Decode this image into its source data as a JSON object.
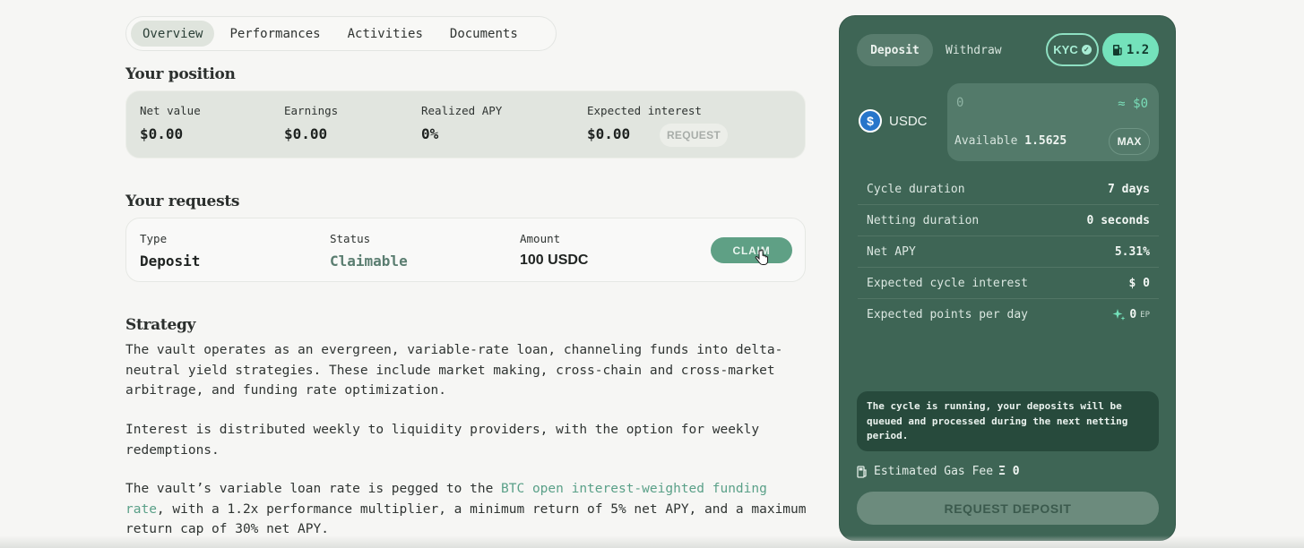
{
  "tabs": [
    {
      "label": "Overview",
      "active": true
    },
    {
      "label": "Performances",
      "active": false
    },
    {
      "label": "Activities",
      "active": false
    },
    {
      "label": "Documents",
      "active": false
    }
  ],
  "position": {
    "title": "Your position",
    "stats": [
      {
        "label": "Net value",
        "value": "$0.00"
      },
      {
        "label": "Earnings",
        "value": "$0.00"
      },
      {
        "label": "Realized APY",
        "value": "0%"
      },
      {
        "label": "Expected interest",
        "value": "$0.00"
      }
    ],
    "request_label": "REQUEST"
  },
  "requests": {
    "title": "Your requests",
    "columns": [
      {
        "label": "Type",
        "value": "Deposit"
      },
      {
        "label": "Status",
        "value": "Claimable"
      },
      {
        "label": "Amount",
        "value": "100 USDC"
      }
    ],
    "claim_label": "CLAIM"
  },
  "strategy": {
    "title": "Strategy",
    "p1": "The vault operates as an evergreen, variable-rate loan, channeling funds into delta-neutral yield strategies. These include market making, cross-chain and cross-market arbitrage, and funding rate optimization.",
    "p2": "Interest is distributed weekly to liquidity providers, with the option for weekly redemptions.",
    "p3_before": "The vault’s variable loan rate is pegged to the ",
    "p3_link": "BTC open interest-weighted funding rate",
    "p3_after": ", with a 1.2x performance multiplier, a minimum return of 5% net APY, and a maximum return cap of 30% net APY."
  },
  "panel": {
    "deposit_tab": "Deposit",
    "withdraw_tab": "Withdraw",
    "kyc_label": "KYC",
    "gas_value": "1.2",
    "token": "USDC",
    "amount_placeholder": "0",
    "amount_usd": "≈ $0",
    "available_label": "Available",
    "available_value": "1.5625",
    "max_label": "MAX",
    "info": [
      {
        "label": "Cycle duration",
        "value": "7 days"
      },
      {
        "label": "Netting duration",
        "value": "0 seconds"
      },
      {
        "label": "Net APY",
        "value": "5.31%"
      },
      {
        "label": "Expected cycle interest",
        "value": "$ 0"
      },
      {
        "label": "Expected points per day",
        "value": "0",
        "unit": "EP"
      }
    ],
    "notice": "The cycle is running, your deposits will be queued and processed during the next netting period.",
    "gas_fee_label": "Estimated Gas Fee",
    "gas_fee_value": "Ξ 0",
    "request_deposit_label": "REQUEST DEPOSIT"
  },
  "colors": {
    "accent": "#5fa085",
    "panel_bg": "#3e6555",
    "mint": "#74e2bb",
    "link": "#5aa088"
  },
  "icons": [
    "check-badge-icon",
    "gas-pump-icon",
    "usdc-icon",
    "sparkle-icon",
    "pointer-hand-icon"
  ]
}
